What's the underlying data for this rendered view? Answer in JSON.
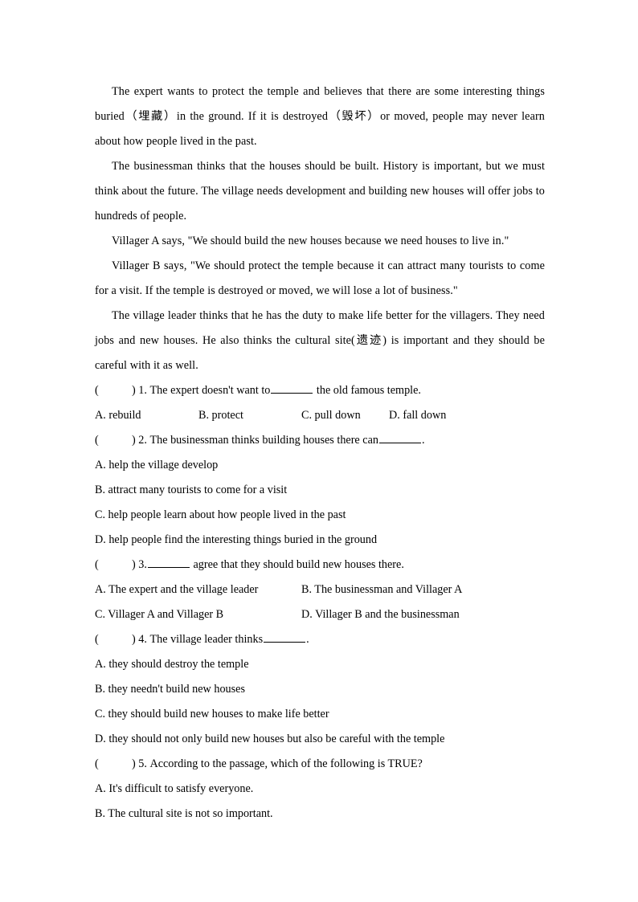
{
  "document": {
    "type": "reading-comprehension-worksheet",
    "language": "English with Chinese glosses",
    "passage": [
      "The expert wants to protect the temple and believes that there are some interesting things buried（埋藏）in the ground. If it is destroyed（毁坏）or moved, people may never learn about how people lived in the past.",
      "The businessman thinks that the houses should be built. History is important, but we must think about the future. The village needs development and building new houses will offer jobs to hundreds of people.",
      "Villager A says, \"We should build the new houses because we need houses to live in.\"",
      "Villager B says, \"We should protect the temple because it can attract many tourists to come for a visit. If the temple is destroyed or moved, we will lose a lot of business.\"",
      "The village leader thinks that he has the duty to make life better for the villagers. They need jobs and new houses. He also thinks the cultural site(遗迹) is important and they should be careful with it as well."
    ],
    "questions": [
      {
        "marker_open": "(",
        "marker_close": ")",
        "number": "1.",
        "stem_before_blank": "The expert doesn't want to",
        "stem_after_blank": "the old famous temple.",
        "layout": "four-across",
        "options": [
          "A. rebuild",
          "B. protect",
          "C. pull down",
          "D. fall down"
        ]
      },
      {
        "marker_open": "(",
        "marker_close": ")",
        "number": "2.",
        "stem_before_blank": "The businessman thinks building houses there can",
        "stem_after_blank": ".",
        "layout": "stacked",
        "options": [
          "A. help the village develop",
          "B. attract many tourists to come for a visit",
          "C. help people learn about how people lived in the past",
          "D. help people find the interesting things buried in the ground"
        ]
      },
      {
        "marker_open": "(",
        "marker_close": ")",
        "number": "3.",
        "stem_before_blank": "",
        "stem_after_blank": "agree that they should build new houses there.",
        "layout": "two-across",
        "options": [
          "A. The expert and the village leader",
          "B. The businessman and Villager A",
          "C. Villager A and Villager B",
          "D. Villager B and the businessman"
        ]
      },
      {
        "marker_open": "(",
        "marker_close": ")",
        "number": "4.",
        "stem_before_blank": "The village leader thinks",
        "stem_after_blank": ".",
        "layout": "stacked",
        "options": [
          "A. they should destroy the temple",
          "B. they needn't build new houses",
          "C. they should build new houses to make life better",
          "D. they should not only build new houses but also be careful with the temple"
        ]
      },
      {
        "marker_open": "(",
        "marker_close": ")",
        "number": "5.",
        "stem_before_blank": "According to the passage, which of the following is TRUE?",
        "stem_after_blank": "",
        "layout": "stacked",
        "options": [
          "A. It's difficult to satisfy everyone.",
          "B. The cultural site is not so important."
        ]
      }
    ]
  },
  "colors": {
    "page_background": "#ffffff",
    "text": "#000000",
    "rule": "#000000"
  }
}
